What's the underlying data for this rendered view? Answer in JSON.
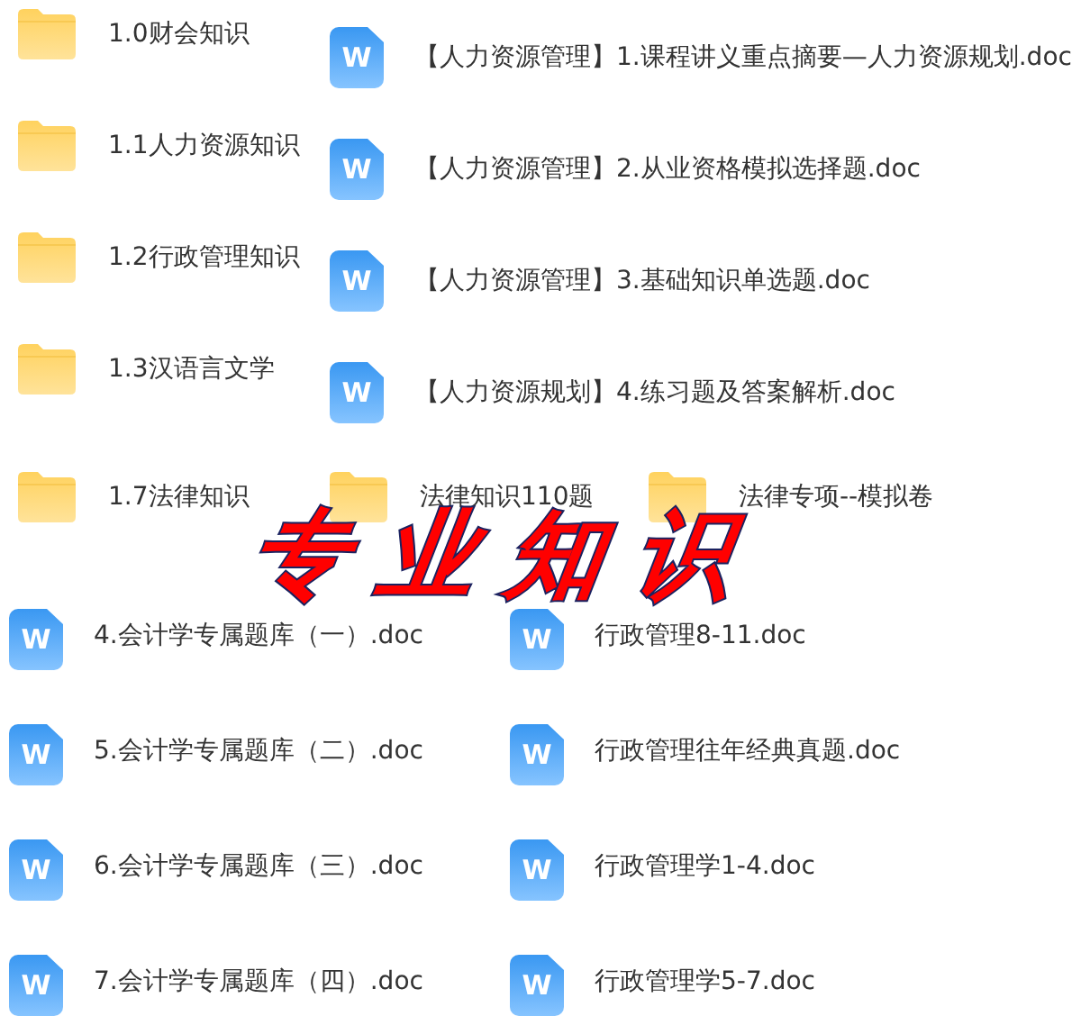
{
  "top_rows": [
    {
      "items": [
        {
          "kind": "folder",
          "name": "1.0财会知识"
        },
        {
          "kind": "doc",
          "icon_letter": "W",
          "name": "【人力资源管理】1.课程讲义重点摘要—人力资源规划.doc"
        }
      ]
    },
    {
      "items": [
        {
          "kind": "folder",
          "name": "1.1人力资源知识"
        },
        {
          "kind": "doc",
          "icon_letter": "W",
          "name": "【人力资源管理】2.从业资格模拟选择题.doc"
        }
      ]
    },
    {
      "items": [
        {
          "kind": "folder",
          "name": "1.2行政管理知识"
        },
        {
          "kind": "doc",
          "icon_letter": "W",
          "name": "【人力资源管理】3.基础知识单选题.doc"
        }
      ]
    },
    {
      "items": [
        {
          "kind": "folder",
          "name": "1.3汉语言文学"
        },
        {
          "kind": "doc",
          "icon_letter": "W",
          "name": "【人力资源规划】4.练习题及答案解析.doc"
        }
      ]
    },
    {
      "items": [
        {
          "kind": "folder",
          "name": "1.7法律知识"
        },
        {
          "kind": "folder",
          "name": "法律知识110题"
        },
        {
          "kind": "folder",
          "name": "法律专项--模拟卷"
        }
      ]
    }
  ],
  "bottom_rows": [
    {
      "items": [
        {
          "kind": "doc",
          "icon_letter": "W",
          "name": "4.会计学专属题库（一）.doc"
        },
        {
          "kind": "doc",
          "icon_letter": "W",
          "name": "行政管理8-11.doc"
        }
      ]
    },
    {
      "items": [
        {
          "kind": "doc",
          "icon_letter": "W",
          "name": "5.会计学专属题库（二）.doc"
        },
        {
          "kind": "doc",
          "icon_letter": "W",
          "name": "行政管理往年经典真题.doc"
        }
      ]
    },
    {
      "items": [
        {
          "kind": "doc",
          "icon_letter": "W",
          "name": "6.会计学专属题库（三）.doc"
        },
        {
          "kind": "doc",
          "icon_letter": "W",
          "name": "行政管理学1-4.doc"
        }
      ]
    },
    {
      "items": [
        {
          "kind": "doc",
          "icon_letter": "W",
          "name": "7.会计学专属题库（四）.doc"
        },
        {
          "kind": "doc",
          "icon_letter": "W",
          "name": "行政管理学5-7.doc"
        }
      ]
    }
  ],
  "banner": "专业知识"
}
